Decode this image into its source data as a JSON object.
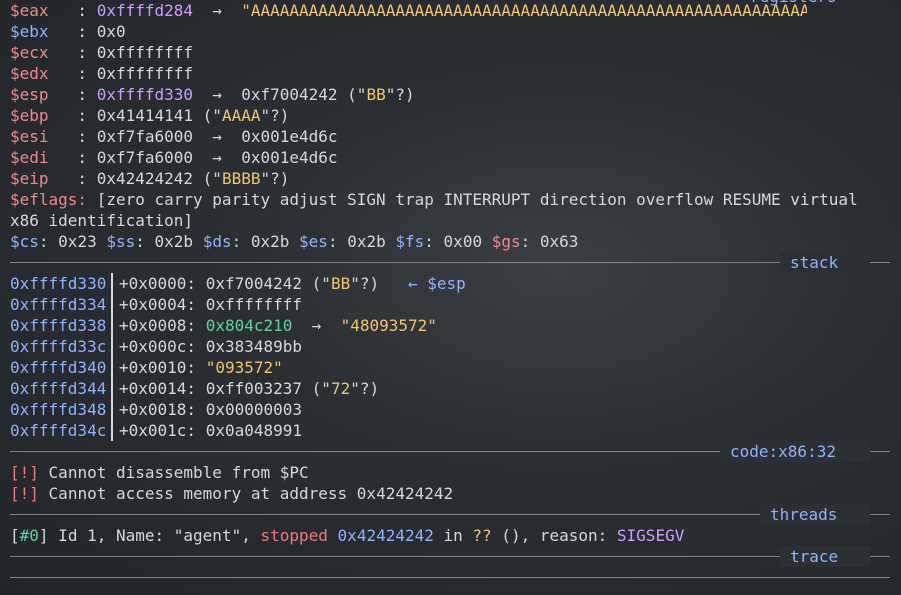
{
  "registers_header": "registers",
  "registers": [
    {
      "name": "$eax",
      "value": "0xffffd284",
      "arrow": "→",
      "deref": "\"AAAAAAAAAAAAAAAAAAAAAAAAAAAAAAAAAAAAAAAAAAAAAAAAAAAAAAAAAAAAAAAAAAAAAAAAAAAAAAAAAAAAAAAAAAAAAAAAAAAAAAAAAAAAAAAAAAAAAAAAAAAAA[...]\""
    },
    {
      "name": "$ebx",
      "value": "0x0"
    },
    {
      "name": "$ecx",
      "value": "0xffffffff"
    },
    {
      "name": "$edx",
      "value": "0xffffffff"
    },
    {
      "name": "$esp",
      "value": "0xffffd330",
      "arrow": "→",
      "deref": "0xf7004242 (\"BB\"?)"
    },
    {
      "name": "$ebp",
      "value": "0x41414141 (\"AAAA\"?)"
    },
    {
      "name": "$esi",
      "value": "0xf7fa6000",
      "arrow": "→",
      "deref": "0x001e4d6c"
    },
    {
      "name": "$edi",
      "value": "0xf7fa6000",
      "arrow": "→",
      "deref": "0x001e4d6c"
    },
    {
      "name": "$eip",
      "value": "0x42424242 (\"BBBB\"?)"
    }
  ],
  "eflags_label": "$eflags:",
  "eflags_value": "[zero carry parity adjust SIGN trap INTERRUPT direction overflow RESUME virtual x86 identification]",
  "segments": [
    {
      "name": "$cs",
      "value": "0x23"
    },
    {
      "name": "$ss",
      "value": "0x2b"
    },
    {
      "name": "$ds",
      "value": "0x2b"
    },
    {
      "name": "$es",
      "value": "0x2b"
    },
    {
      "name": "$fs",
      "value": "0x00"
    },
    {
      "name": "$gs",
      "value": "0x63"
    }
  ],
  "stack_header": "stack",
  "stack": [
    {
      "addr": "0xffffd330",
      "off": "+0x0000:",
      "val": "0xf7004242 (\"BB\"?)",
      "note": "← $esp"
    },
    {
      "addr": "0xffffd334",
      "off": "+0x0004:",
      "val": "0xffffffff"
    },
    {
      "addr": "0xffffd338",
      "off": "+0x0008:",
      "val": "0x804c210",
      "arrow": "→",
      "deref": "\"48093572\""
    },
    {
      "addr": "0xffffd33c",
      "off": "+0x000c:",
      "val": "0x383489bb"
    },
    {
      "addr": "0xffffd340",
      "off": "+0x0010:",
      "val": "\"093572\""
    },
    {
      "addr": "0xffffd344",
      "off": "+0x0014:",
      "val": "0xff003237 (\"72\"?)"
    },
    {
      "addr": "0xffffd348",
      "off": "+0x0018:",
      "val": "0x00000003"
    },
    {
      "addr": "0xffffd34c",
      "off": "+0x001c:",
      "val": "0x0a048991"
    }
  ],
  "code_header": "code:x86:32",
  "code_errors": [
    {
      "tag": "[!]",
      "msg": "Cannot disassemble from $PC"
    },
    {
      "tag": "[!]",
      "msg": "Cannot access memory at address 0x42424242"
    }
  ],
  "threads_header": "threads",
  "thread": {
    "id_tag": "[#0]",
    "text1": " Id 1, Name: \"agent\", ",
    "state": "stopped",
    "addr": "0x42424242",
    "in": " in ",
    "func": "??",
    "text2": " (), reason: ",
    "reason": "SIGSEGV"
  },
  "trace_header": "trace"
}
